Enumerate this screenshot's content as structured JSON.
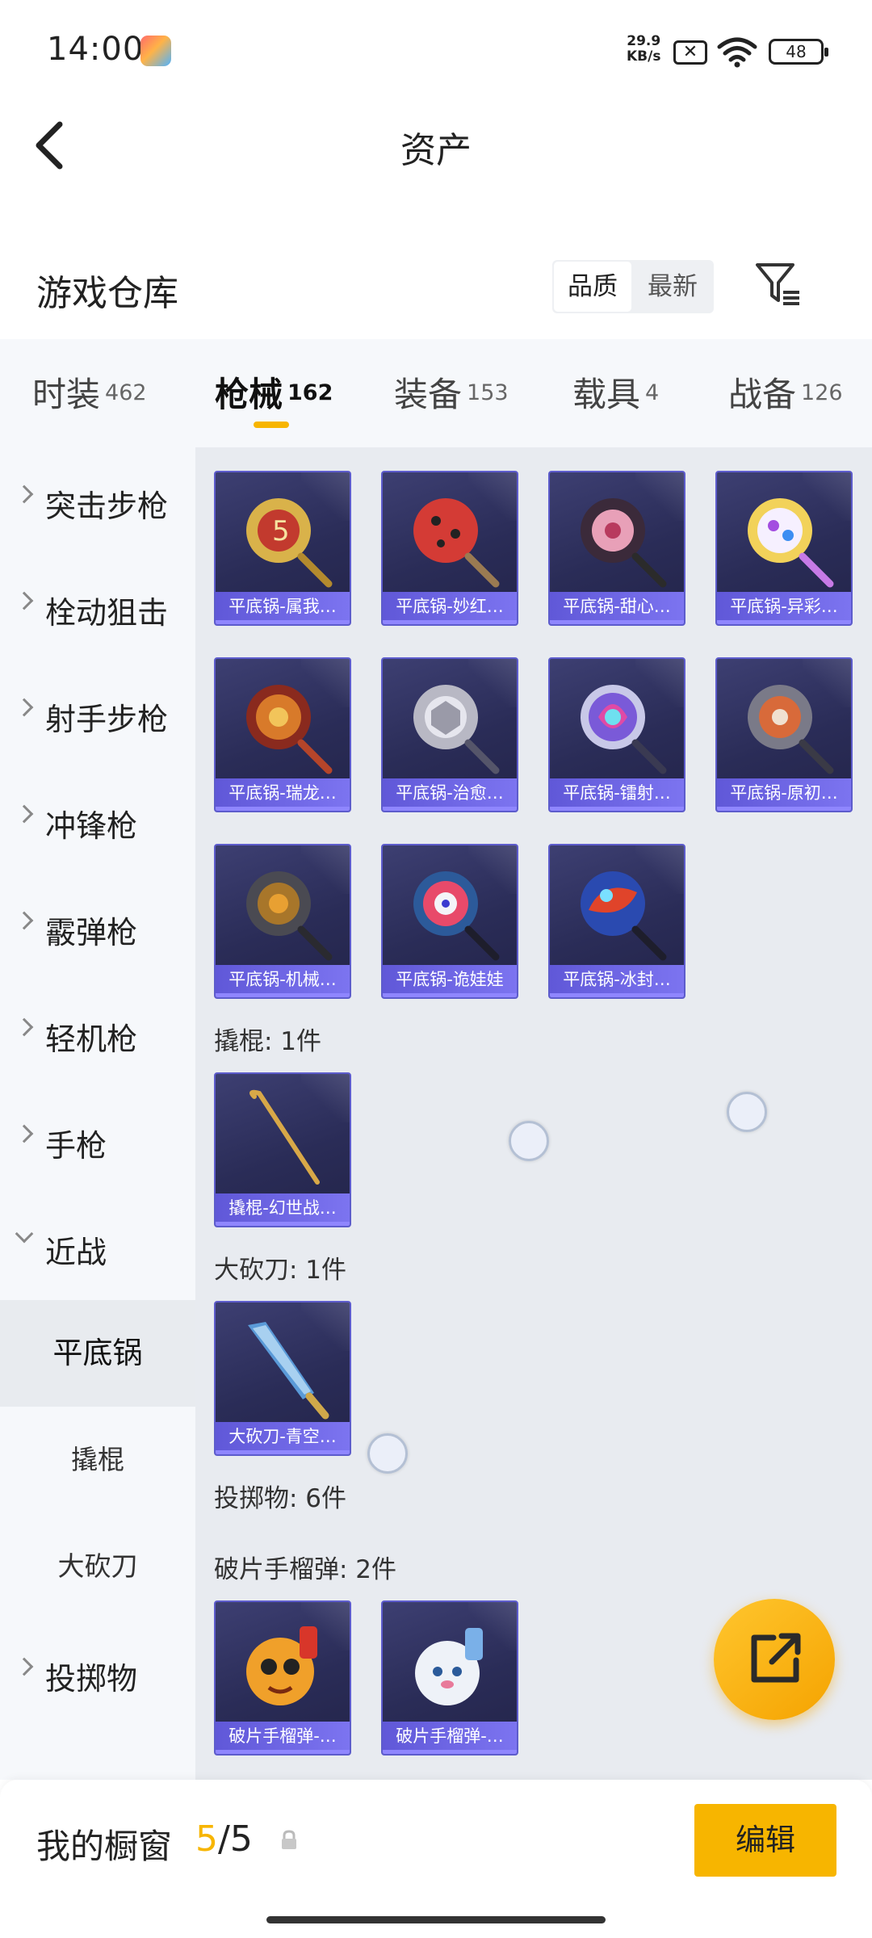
{
  "status_bar": {
    "time": "14:00",
    "speed_value": "29.9",
    "speed_unit": "KB/s",
    "battery": "48"
  },
  "header": {
    "title": "资产"
  },
  "warehouse": {
    "title": "游戏仓库",
    "sort_quality": "品质",
    "sort_newest": "最新"
  },
  "tabs": [
    {
      "label": "时装",
      "count": "462"
    },
    {
      "label": "枪械",
      "count": "162",
      "active": true
    },
    {
      "label": "装备",
      "count": "153"
    },
    {
      "label": "载具",
      "count": "4"
    },
    {
      "label": "战备",
      "count": "126"
    }
  ],
  "sidebar": {
    "items": [
      {
        "label": "突击步枪"
      },
      {
        "label": "栓动狙击"
      },
      {
        "label": "射手步枪"
      },
      {
        "label": "冲锋枪"
      },
      {
        "label": "霰弹枪"
      },
      {
        "label": "轻机枪"
      },
      {
        "label": "手枪"
      },
      {
        "label": "近战",
        "expanded": true
      },
      {
        "label": "平底锅",
        "sub": true,
        "selected": true
      },
      {
        "label": "撬棍",
        "sub": true
      },
      {
        "label": "大砍刀",
        "sub": true
      },
      {
        "label": "投掷物"
      }
    ]
  },
  "sections": {
    "crowbar_label": "撬棍: 1件",
    "machete_label": "大砍刀: 1件",
    "throwables_label": "投掷物: 6件",
    "frag_label": "破片手榴弹: 2件"
  },
  "items": {
    "pans": [
      "平底锅-属我…",
      "平底锅-妙红…",
      "平底锅-甜心…",
      "平底锅-异彩…",
      "平底锅-瑞龙…",
      "平底锅-治愈…",
      "平底锅-镭射…",
      "平底锅-原初…",
      "平底锅-机械…",
      "平底锅-诡娃娃",
      "平底锅-冰封…"
    ],
    "crowbar": [
      "撬棍-幻世战…"
    ],
    "machete": [
      "大砍刀-青空…"
    ],
    "frag": [
      "破片手榴弹-…",
      "破片手榴弹-…"
    ]
  },
  "showcase": {
    "title": "我的橱窗",
    "count_used": "5",
    "count_sep": "/",
    "count_total": "5",
    "edit_label": "编辑"
  },
  "colors": {
    "accent": "#f7b500",
    "card_border": "#5d5ccc",
    "card_bar": "#6c64e4"
  },
  "icons": {
    "back": "back-arrow-icon",
    "filter": "filter-icon",
    "fab": "share-external-icon",
    "lock": "lock-icon"
  }
}
